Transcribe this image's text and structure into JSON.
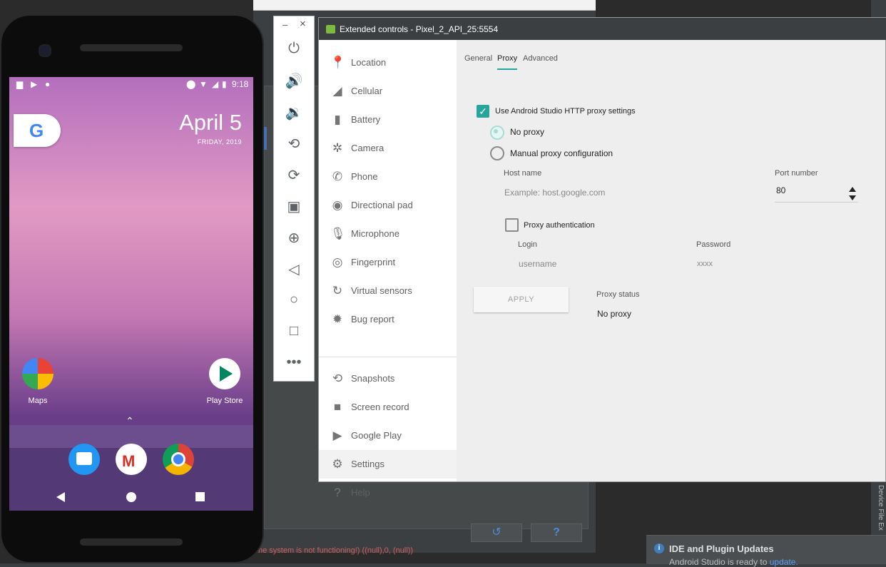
{
  "ide": {
    "error_text": "ne system is not functioning!) ((null),0, (null))",
    "refresh_glyph": "↺",
    "help_glyph": "?",
    "side_panel_label": "Device File Ex",
    "notification": {
      "icon": "info-icon",
      "title": "IDE and Plugin Updates",
      "body_prefix": "Android Studio is ready to ",
      "body_link": "update."
    }
  },
  "phone": {
    "status_time": "9:18",
    "date": "April 5",
    "date_sub": "FRIDAY, 2019",
    "google_letter": "G",
    "apps": [
      {
        "label": "Maps",
        "icon": "maps-icon",
        "color": "#34a853"
      },
      {
        "label": "Play Store",
        "icon": "play-store-icon",
        "color": "#ffffff"
      }
    ],
    "dock": [
      {
        "icon": "messages-icon",
        "color": "#2196f3"
      },
      {
        "icon": "gmail-icon",
        "color": "#ffffff"
      },
      {
        "icon": "chrome-icon",
        "color": "#ffffff"
      }
    ]
  },
  "toolbar": {
    "minimize": "–",
    "close": "×",
    "buttons": [
      "power-icon",
      "volume-up-icon",
      "volume-down-icon",
      "rotate-left-icon",
      "rotate-right-icon",
      "camera-icon",
      "zoom-icon",
      "back-icon",
      "home-icon",
      "overview-icon",
      "more-icon"
    ]
  },
  "extended": {
    "title": "Extended controls - Pixel_2_API_25:5554",
    "nav": [
      {
        "label": "Location",
        "icon": "location-icon"
      },
      {
        "label": "Cellular",
        "icon": "cellular-icon"
      },
      {
        "label": "Battery",
        "icon": "battery-icon"
      },
      {
        "label": "Camera",
        "icon": "camera-icon"
      },
      {
        "label": "Phone",
        "icon": "phone-icon"
      },
      {
        "label": "Directional pad",
        "icon": "dpad-icon"
      },
      {
        "label": "Microphone",
        "icon": "microphone-icon"
      },
      {
        "label": "Fingerprint",
        "icon": "fingerprint-icon"
      },
      {
        "label": "Virtual sensors",
        "icon": "virtual-sensors-icon"
      },
      {
        "label": "Bug report",
        "icon": "bug-icon"
      },
      {
        "label": "Snapshots",
        "icon": "snapshots-icon"
      },
      {
        "label": "Screen record",
        "icon": "screen-record-icon"
      },
      {
        "label": "Google Play",
        "icon": "google-play-icon"
      },
      {
        "label": "Settings",
        "icon": "settings-icon"
      },
      {
        "label": "Help",
        "icon": "help-icon"
      }
    ],
    "selected_nav": "Settings",
    "tabs": [
      "General",
      "Proxy",
      "Advanced"
    ],
    "active_tab": "Proxy",
    "proxy": {
      "use_studio_label": "Use Android Studio HTTP proxy settings",
      "use_studio_checked": true,
      "no_proxy_label": "No proxy",
      "manual_label": "Manual proxy configuration",
      "selected_option": "No proxy",
      "host_label": "Host name",
      "host_placeholder": "Example: host.google.com",
      "port_label": "Port number",
      "port_value": "80",
      "auth_label": "Proxy authentication",
      "auth_checked": false,
      "login_label": "Login",
      "login_placeholder": "username",
      "password_label": "Password",
      "password_placeholder": "xxxx",
      "apply_label": "APPLY",
      "status_label": "Proxy status",
      "status_value": "No proxy"
    },
    "accent_color": "#26a69a"
  }
}
